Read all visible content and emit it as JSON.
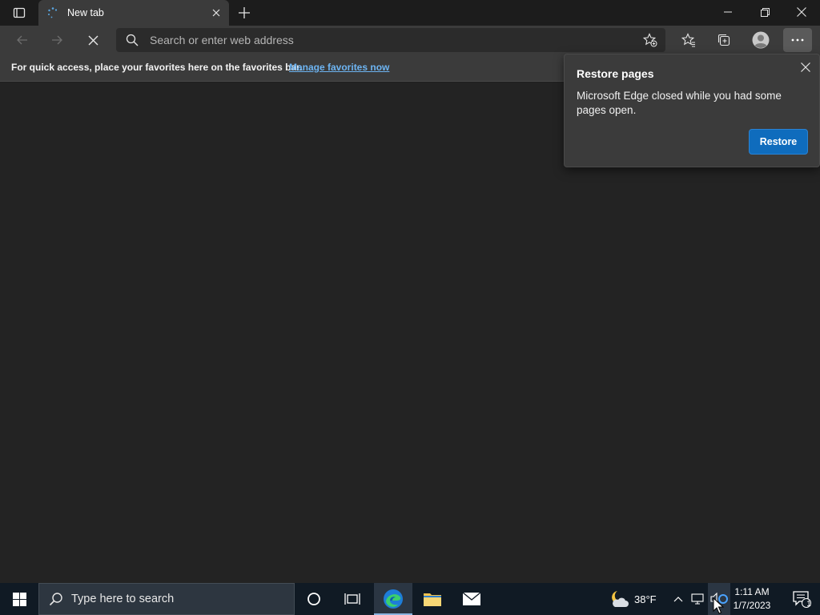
{
  "tab": {
    "title": "New tab"
  },
  "address": {
    "placeholder": "Search or enter web address"
  },
  "favbar": {
    "message": "For quick access, place your favorites here on the favorites bar.",
    "link": "Manage favorites now"
  },
  "restore": {
    "title": "Restore pages",
    "message": "Microsoft Edge closed while you had some pages open.",
    "button": "Restore"
  },
  "taskbar": {
    "search_placeholder": "Type here to search",
    "weather_temp": "38°F",
    "time": "1:11 AM",
    "date": "1/7/2023",
    "notification_count": "1"
  },
  "colors": {
    "accent": "#0f6cbd",
    "link": "#6db4f2",
    "toolbar": "#3b3b3b",
    "taskbar": "#101a24"
  }
}
